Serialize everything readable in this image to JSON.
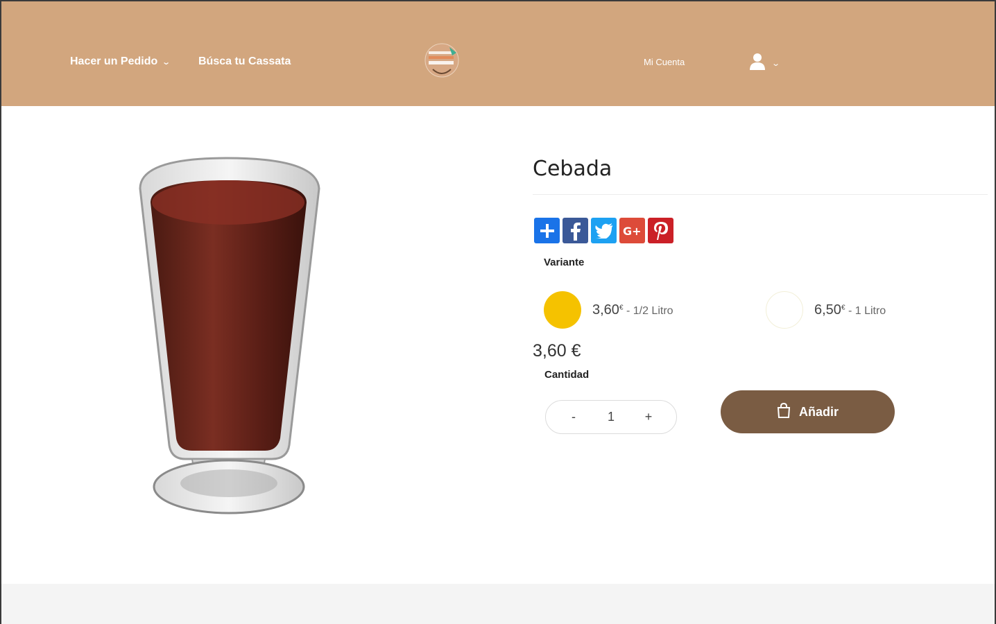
{
  "header": {
    "nav_order": "Hacer un Pedido",
    "nav_search": "Búsca tu Cassata",
    "account": "Mi Cuenta",
    "background": "#d2a67e"
  },
  "product": {
    "title": "Cebada",
    "variant_label": "Variante",
    "variants": [
      {
        "price": "3,60",
        "currency": "€",
        "size": "- 1/2 Litro",
        "color": "#f5c200",
        "selected": true
      },
      {
        "price": "6,50",
        "currency": "€",
        "size": "- 1 Litro",
        "color": "#ffffff",
        "selected": false
      }
    ],
    "price": "3,60 €",
    "quantity_label": "Cantidad",
    "quantity": "1",
    "minus": "-",
    "plus": "+",
    "add_label": "Añadir"
  },
  "share": {
    "icons": [
      "share-plus-icon",
      "facebook-icon",
      "twitter-icon",
      "google-plus-icon",
      "pinterest-icon"
    ],
    "colors": [
      "#1a73e8",
      "#3b5998",
      "#1da1f2",
      "#dd4b39",
      "#cb2027"
    ]
  },
  "colors": {
    "button": "#7a5c43",
    "footer": "#f4f4f4"
  }
}
